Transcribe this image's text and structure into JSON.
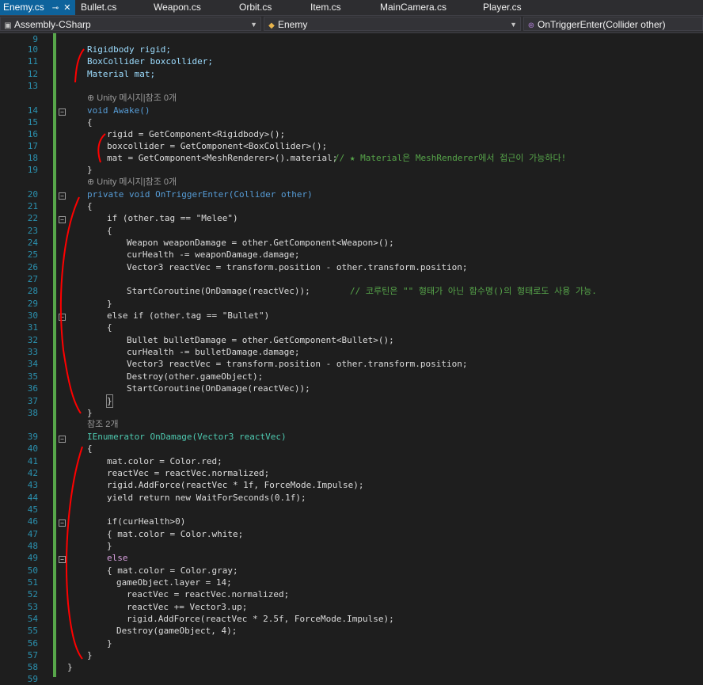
{
  "tabs": [
    {
      "label": "Enemy.cs",
      "active": true
    },
    {
      "label": "Bullet.cs"
    },
    {
      "label": "Weapon.cs"
    },
    {
      "label": "Orbit.cs"
    },
    {
      "label": "Item.cs"
    },
    {
      "label": "MainCamera.cs"
    },
    {
      "label": "Player.cs"
    }
  ],
  "navbar": {
    "project": "Assembly-CSharp",
    "class": "Enemy",
    "member": "OnTriggerEnter(Collider other)"
  },
  "hints": {
    "awake": "Unity 메시지|참조 0개",
    "trigger": "Unity 메시지|참조 0개",
    "ondamage": "참조 2개"
  },
  "colors": {
    "accent": "#0e639c",
    "annotation": "#ff0000"
  },
  "lines": [
    {
      "n": 9,
      "t": ""
    },
    {
      "n": 10,
      "t": "Rigidbody rigid;"
    },
    {
      "n": 11,
      "t": "BoxCollider boxcollider;"
    },
    {
      "n": 12,
      "t": "Material mat;"
    },
    {
      "n": 13,
      "t": ""
    },
    {
      "n": 14,
      "t": "void Awake()"
    },
    {
      "n": 15,
      "t": "{"
    },
    {
      "n": 16,
      "t": "rigid = GetComponent<Rigidbody>();"
    },
    {
      "n": 17,
      "t": "boxcollider = GetComponent<BoxCollider>();"
    },
    {
      "n": 18,
      "t": "mat = GetComponent<MeshRenderer>().material;"
    },
    {
      "n": 19,
      "t": "}"
    },
    {
      "n": 20,
      "t": "private void OnTriggerEnter(Collider other)"
    },
    {
      "n": 21,
      "t": "{"
    },
    {
      "n": 22,
      "t": "if (other.tag == \"Melee\")"
    },
    {
      "n": 23,
      "t": "{"
    },
    {
      "n": 24,
      "t": "Weapon weaponDamage = other.GetComponent<Weapon>();"
    },
    {
      "n": 25,
      "t": "curHealth -= weaponDamage.damage;"
    },
    {
      "n": 26,
      "t": "Vector3 reactVec = transform.position - other.transform.position;"
    },
    {
      "n": 27,
      "t": ""
    },
    {
      "n": 28,
      "t": "StartCoroutine(OnDamage(reactVec));"
    },
    {
      "n": 29,
      "t": "}"
    },
    {
      "n": 30,
      "t": "else if (other.tag == \"Bullet\")"
    },
    {
      "n": 31,
      "t": "{"
    },
    {
      "n": 32,
      "t": "Bullet bulletDamage = other.GetComponent<Bullet>();"
    },
    {
      "n": 33,
      "t": "curHealth -= bulletDamage.damage;"
    },
    {
      "n": 34,
      "t": "Vector3 reactVec = transform.position - other.transform.position;"
    },
    {
      "n": 35,
      "t": "Destroy(other.gameObject);"
    },
    {
      "n": 36,
      "t": "StartCoroutine(OnDamage(reactVec));"
    },
    {
      "n": 37,
      "t": "}"
    },
    {
      "n": 38,
      "t": "}"
    },
    {
      "n": 39,
      "t": "IEnumerator OnDamage(Vector3 reactVec)"
    },
    {
      "n": 40,
      "t": "{"
    },
    {
      "n": 41,
      "t": "mat.color = Color.red;"
    },
    {
      "n": 42,
      "t": "reactVec = reactVec.normalized;"
    },
    {
      "n": 43,
      "t": "rigid.AddForce(reactVec * 1f, ForceMode.Impulse);"
    },
    {
      "n": 44,
      "t": "yield return new WaitForSeconds(0.1f);"
    },
    {
      "n": 45,
      "t": ""
    },
    {
      "n": 46,
      "t": "if(curHealth>0)"
    },
    {
      "n": 47,
      "t": "{ mat.color = Color.white;"
    },
    {
      "n": 48,
      "t": "}"
    },
    {
      "n": 49,
      "t": "else"
    },
    {
      "n": 50,
      "t": "{ mat.color = Color.gray;"
    },
    {
      "n": 51,
      "t": "gameObject.layer = 14;"
    },
    {
      "n": 52,
      "t": "reactVec = reactVec.normalized;"
    },
    {
      "n": 53,
      "t": "reactVec += Vector3.up;"
    },
    {
      "n": 54,
      "t": "rigid.AddForce(reactVec * 2.5f, ForceMode.Impulse);"
    },
    {
      "n": 55,
      "t": "Destroy(gameObject, 4);"
    },
    {
      "n": 56,
      "t": "}"
    },
    {
      "n": 57,
      "t": "}"
    },
    {
      "n": 58,
      "t": "}"
    },
    {
      "n": 59,
      "t": ""
    }
  ],
  "comments": {
    "line18": "// ★ Material은 MeshRenderer에서 접근이 가능하다!",
    "line28": "// 코루틴은 \"\" 형태가 아닌 함수명()의 형태로도 사용 가능."
  }
}
